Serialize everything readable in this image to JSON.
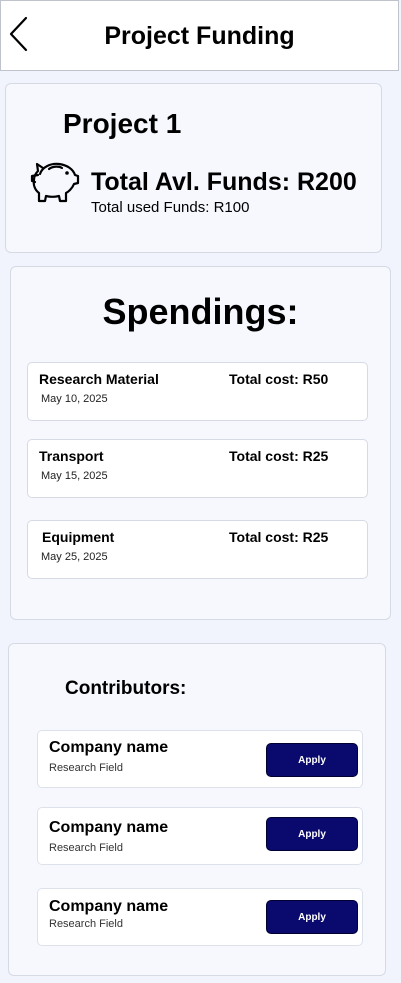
{
  "header": {
    "title": "Project Funding",
    "back_icon": "chevron-left-icon"
  },
  "project": {
    "name": "Project 1",
    "icon": "piggy-bank-icon",
    "available_funds": "Total Avl. Funds:  R200",
    "used_funds": "Total used Funds: R100"
  },
  "spendings": {
    "heading": "Spendings:",
    "items": [
      {
        "name": "Research Material",
        "cost": "Total cost: R50",
        "date": "May 10, 2025"
      },
      {
        "name": "Transport",
        "cost": "Total cost: R25",
        "date": "May 15, 2025"
      },
      {
        "name": "Equipment",
        "cost": "Total cost: R25",
        "date": "May 25, 2025"
      }
    ]
  },
  "contributors": {
    "heading": "Contributors:",
    "items": [
      {
        "name": "Company name",
        "field": "Research Field",
        "action": "Apply"
      },
      {
        "name": "Company name",
        "field": "Research Field",
        "action": "Apply"
      },
      {
        "name": "Company name",
        "field": "Research Field",
        "action": "Apply"
      }
    ]
  },
  "colors": {
    "background": "#f1f4fd",
    "card": "#f6f8fe",
    "button": "#0a0a6e"
  }
}
